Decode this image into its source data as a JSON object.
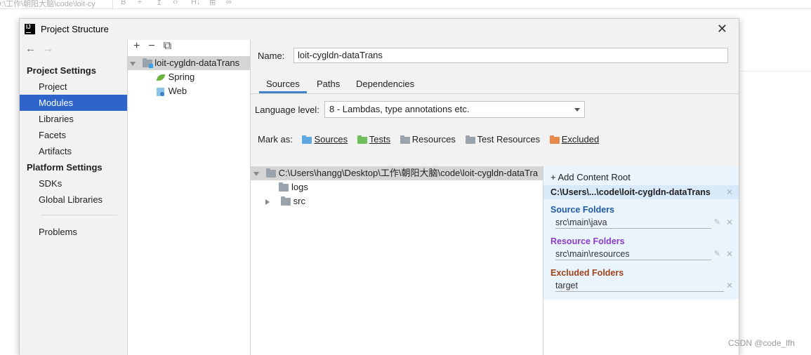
{
  "background": {
    "toolbar_text": "D:\\工作\\朝阳大脑\\code\\loit-cy",
    "watermark": "CSDN @code_lfh"
  },
  "dialog": {
    "title": "Project Structure",
    "app_icon_text": "IJ"
  },
  "nav": {
    "back": "←",
    "forward": "→",
    "project_settings_heading": "Project Settings",
    "project_settings": [
      "Project",
      "Modules",
      "Libraries",
      "Facets",
      "Artifacts"
    ],
    "platform_settings_heading": "Platform Settings",
    "platform_settings": [
      "SDKs",
      "Global Libraries"
    ],
    "problems": "Problems",
    "selected": "Modules"
  },
  "module_tree": {
    "toolbar": [
      "+",
      "−",
      "⧉"
    ],
    "module": "loit-cygldn-dataTrans",
    "facets": [
      {
        "label": "Spring",
        "icon": "spring-icon"
      },
      {
        "label": "Web",
        "icon": "web-icon"
      }
    ]
  },
  "module_detail": {
    "name_label": "Name:",
    "name_value": "loit-cygldn-dataTrans",
    "tabs": [
      "Sources",
      "Paths",
      "Dependencies"
    ],
    "active_tab": "Sources",
    "language_level_label": "Language level:",
    "language_level_value": "8 - Lambdas, type annotations etc.",
    "mark_as_label": "Mark as:",
    "mark_as": [
      {
        "label": "Sources",
        "color": "#5ea7e0"
      },
      {
        "label": "Tests",
        "color": "#6fbf5a"
      },
      {
        "label": "Resources",
        "color": "#9aa2ac"
      },
      {
        "label": "Test Resources",
        "color": "#9aa2ac"
      },
      {
        "label": "Excluded",
        "color": "#e8884a"
      }
    ],
    "content_root_path": "C:\\Users\\hangg\\Desktop\\工作\\朝阳大脑\\code\\loit-cygldn-dataTra",
    "root_children": [
      "logs",
      "src"
    ]
  },
  "content_root_panel": {
    "add_label": "Add Content Root",
    "root": "C:\\Users\\...\\code\\loit-cygldn-dataTrans",
    "source_heading": "Source Folders",
    "source_color": "#1f5aa6",
    "source_path": "src\\main\\java",
    "resource_heading": "Resource Folders",
    "resource_color": "#8a3bc9",
    "resource_path": "src\\main\\resources",
    "excluded_heading": "Excluded Folders",
    "excluded_color": "#a0421a",
    "excluded_path": "target"
  }
}
